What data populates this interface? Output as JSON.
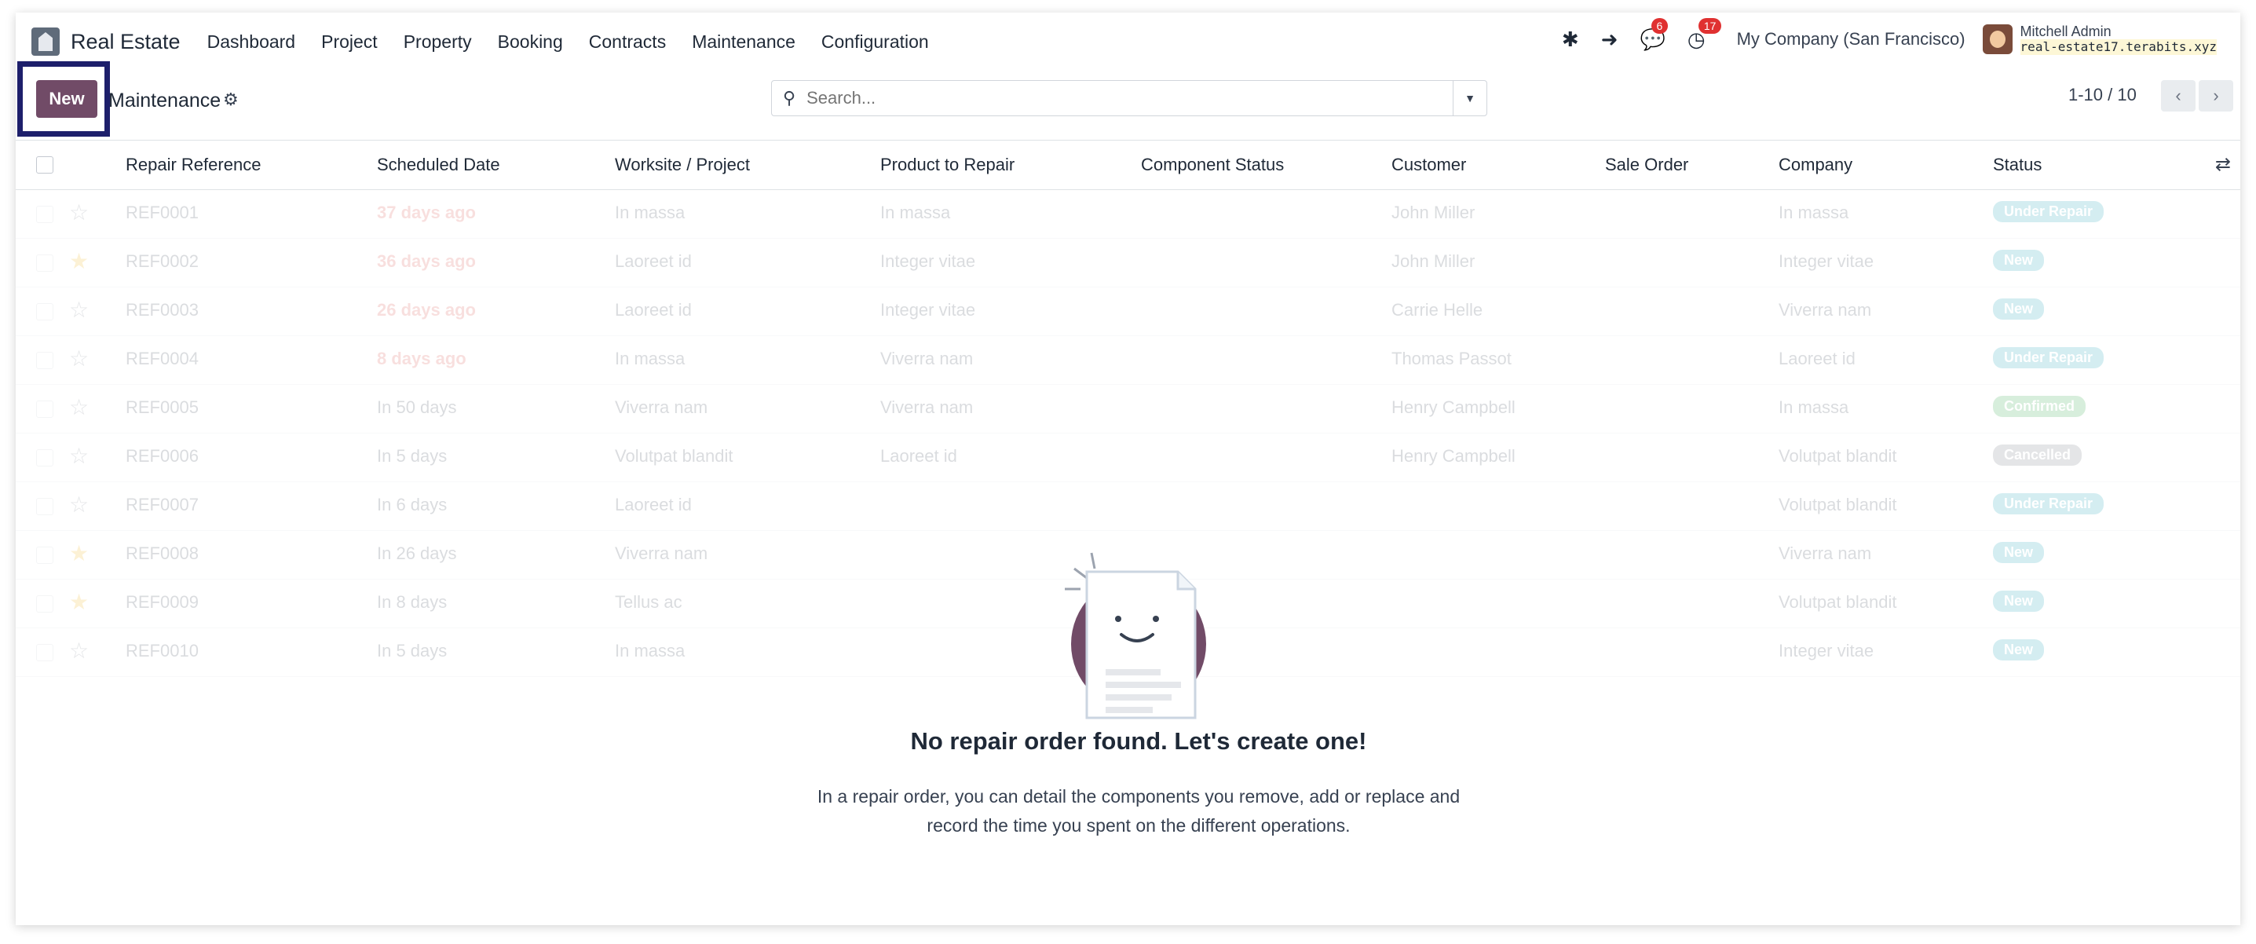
{
  "navbar": {
    "app_name": "Real Estate",
    "menu": [
      "Dashboard",
      "Project",
      "Property",
      "Booking",
      "Contracts",
      "Maintenance",
      "Configuration"
    ],
    "messages_count": "6",
    "activities_count": "17",
    "company": "My Company (San Francisco)",
    "user_name": "Mitchell Admin",
    "database": "real-estate17.terabits.xyz"
  },
  "control": {
    "new_label": "New",
    "breadcrumb": "Maintenance",
    "search_placeholder": "Search...",
    "pager": "1-10 / 10"
  },
  "table": {
    "columns": [
      "Repair Reference",
      "Scheduled Date",
      "Worksite / Project",
      "Product to Repair",
      "Component Status",
      "Customer",
      "Sale Order",
      "Company",
      "Status"
    ],
    "rows": [
      {
        "ref": "REF0001",
        "date": "37 days ago",
        "late": true,
        "worksite": "In massa",
        "product": "In massa",
        "customer": "John Miller",
        "company": "In massa",
        "status": "Under Repair",
        "favorite": false
      },
      {
        "ref": "REF0002",
        "date": "36 days ago",
        "late": true,
        "worksite": "Laoreet id",
        "product": "Integer vitae",
        "customer": "John Miller",
        "company": "Integer vitae",
        "status": "New",
        "favorite": true
      },
      {
        "ref": "REF0003",
        "date": "26 days ago",
        "late": true,
        "worksite": "Laoreet id",
        "product": "Integer vitae",
        "customer": "Carrie Helle",
        "company": "Viverra nam",
        "status": "New",
        "favorite": false
      },
      {
        "ref": "REF0004",
        "date": "8 days ago",
        "late": true,
        "worksite": "In massa",
        "product": "Viverra nam",
        "customer": "Thomas Passot",
        "company": "Laoreet id",
        "status": "Under Repair",
        "favorite": false
      },
      {
        "ref": "REF0005",
        "date": "In 50 days",
        "late": false,
        "worksite": "Viverra nam",
        "product": "Viverra nam",
        "customer": "Henry Campbell",
        "company": "In massa",
        "status": "Confirmed",
        "favorite": false
      },
      {
        "ref": "REF0006",
        "date": "In 5 days",
        "late": false,
        "worksite": "Volutpat blandit",
        "product": "Laoreet id",
        "customer": "Henry Campbell",
        "company": "Volutpat blandit",
        "status": "Cancelled",
        "favorite": false
      },
      {
        "ref": "REF0007",
        "date": "In 6 days",
        "late": false,
        "worksite": "Laoreet id",
        "product": "",
        "customer": "",
        "company": "Volutpat blandit",
        "status": "Under Repair",
        "favorite": false
      },
      {
        "ref": "REF0008",
        "date": "In 26 days",
        "late": false,
        "worksite": "Viverra nam",
        "product": "",
        "customer": "",
        "company": "Viverra nam",
        "status": "New",
        "favorite": true
      },
      {
        "ref": "REF0009",
        "date": "In 8 days",
        "late": false,
        "worksite": "Tellus ac",
        "product": "",
        "customer": "",
        "company": "Volutpat blandit",
        "status": "New",
        "favorite": true
      },
      {
        "ref": "REF0010",
        "date": "In 5 days",
        "late": false,
        "worksite": "In massa",
        "product": "",
        "customer": "",
        "company": "Integer vitae",
        "status": "New",
        "favorite": false
      }
    ]
  },
  "empty_state": {
    "title": "No repair order found. Let's create one!",
    "text": "In a repair order, you can detail the components you remove, add or replace and record the time you spent on the different operations."
  },
  "colors": {
    "primary": "#714b67",
    "highlight_border": "#1d1f6b",
    "late_date": "#d9534f",
    "status_info": "#17a2b8"
  }
}
